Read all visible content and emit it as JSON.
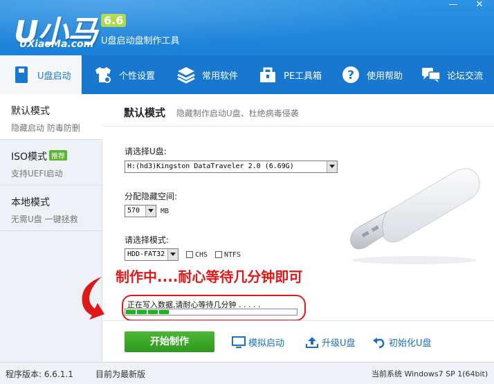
{
  "app": {
    "logo_text": "U小马",
    "version_badge": "6.6",
    "site": "UXiaoMa.com",
    "tagline": "U盘启动盘制作工具",
    "minimize": "—",
    "close": "✕"
  },
  "nav": {
    "items": [
      {
        "label": "U盘启动",
        "icon": "usb-drive-icon"
      },
      {
        "label": "个性设置",
        "icon": "shirt-icon"
      },
      {
        "label": "常用软件",
        "icon": "stack-icon"
      },
      {
        "label": "PE工具箱",
        "icon": "toolbox-icon"
      },
      {
        "label": "使用帮助",
        "icon": "help-icon"
      },
      {
        "label": "论坛交流",
        "icon": "chat-icon"
      }
    ],
    "active_index": 0
  },
  "sidebar": {
    "items": [
      {
        "title": "默认模式",
        "sub": "隐藏启动 防毒防删"
      },
      {
        "title": "ISO模式",
        "badge": "推荐",
        "sub": "支持UEFI启动"
      },
      {
        "title": "本地模式",
        "sub": "无需U盘 一键拯救"
      }
    ],
    "active_index": 0
  },
  "main": {
    "title": "默认模式",
    "description": "隐藏制作启动U盘、杜绝病毒侵袭",
    "select_disk_label": "请选择U盘:",
    "disk_value": "H:(hd3)Kingston DataTraveler 2.0 (6.69G)",
    "hidden_space_label": "分配隐藏空间:",
    "hidden_space_value": "570",
    "hidden_space_unit": "MB",
    "mode_label": "请选择模式:",
    "mode_value": "HDD-FAT32",
    "chs_label": "CHS",
    "ntfs_label": "NTFS",
    "notice": "制作中....耐心等待几分钟即可",
    "status_text": "正在写入数据,请耐心等待几分钟 . . . . .",
    "progress_percent": 28,
    "progress_color": "#1cb41c",
    "accent_red": "#e01818"
  },
  "actions": {
    "start": "开始制作",
    "simulate": "模拟启动",
    "upgrade": "升级U盘",
    "init": "初始化U盘"
  },
  "statusbar": {
    "version": "程序版本: 6.6.1.1",
    "latest": "目前为最新版",
    "system": "当前系统 Windows7 SP 1(64bit)"
  },
  "colors": {
    "header_blue": "#1a7fd6",
    "nav_blue": "#1878d0",
    "start_green": "#3aa828",
    "link_blue": "#1a6fc5"
  }
}
